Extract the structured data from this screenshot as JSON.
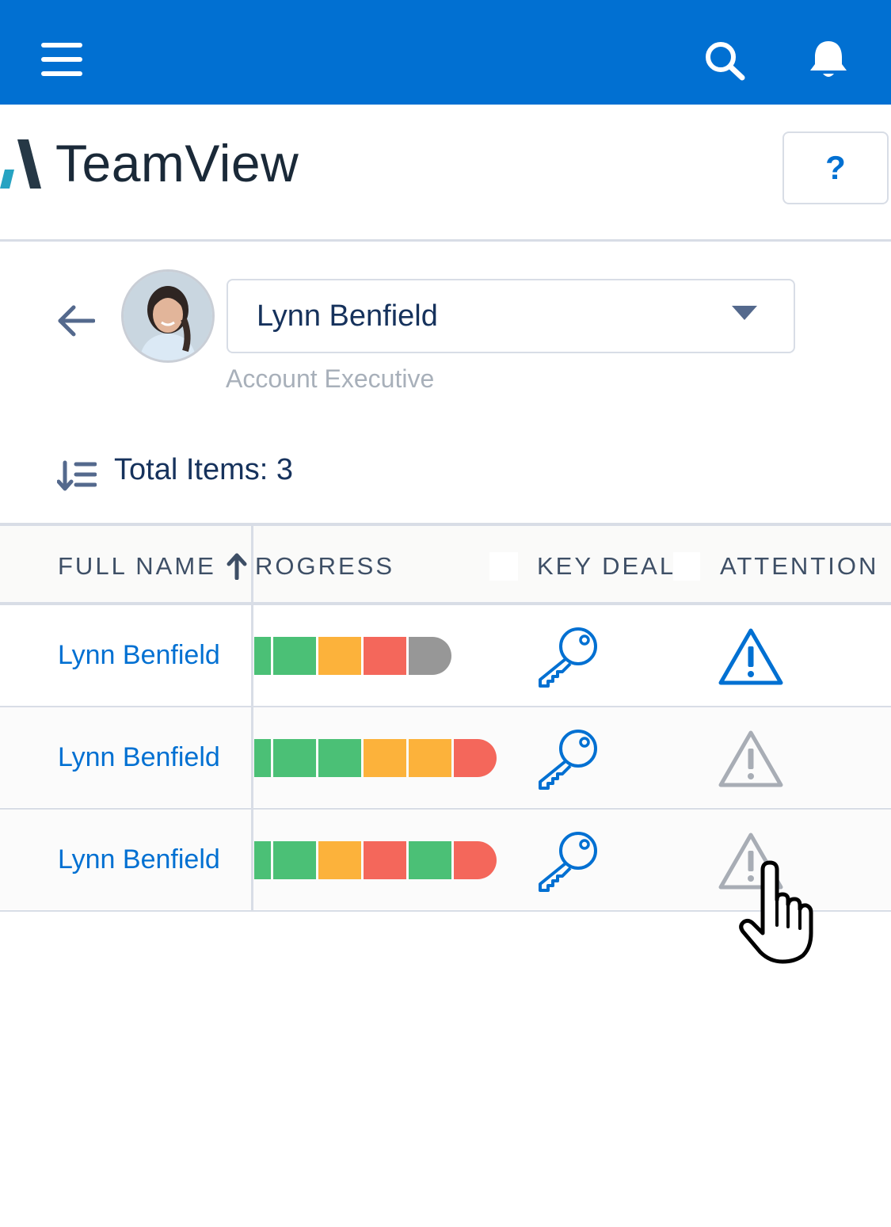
{
  "header": {
    "icons": [
      "menu-icon",
      "search-icon",
      "bell-icon"
    ]
  },
  "app": {
    "title": "TeamView",
    "help_label": "?"
  },
  "user": {
    "name": "Lynn Benfield",
    "role": "Account Executive"
  },
  "summary": {
    "total_label": "Total Items: 3"
  },
  "table": {
    "columns": {
      "full_name": "FULL NAME",
      "progress": "ROGRESS",
      "key_deal": "KEY DEAL",
      "attention": "ATTENTION"
    },
    "rows": [
      {
        "name": "Lynn Benfield",
        "progress": [
          "green",
          "green",
          "orange",
          "red",
          "gray"
        ],
        "key_deal": true,
        "attention": "active"
      },
      {
        "name": "Lynn Benfield",
        "progress": [
          "green",
          "green",
          "green",
          "orange",
          "orange",
          "red"
        ],
        "key_deal": true,
        "attention": "inactive"
      },
      {
        "name": "Lynn Benfield",
        "progress": [
          "green",
          "green",
          "orange",
          "red",
          "green",
          "red"
        ],
        "key_deal": true,
        "attention": "inactive"
      }
    ]
  },
  "colors": {
    "brand": "#0170d2",
    "link": "#0070d2",
    "green": "#4bc076",
    "orange": "#fcb23b",
    "red": "#f4675b",
    "gray": "#979797"
  }
}
